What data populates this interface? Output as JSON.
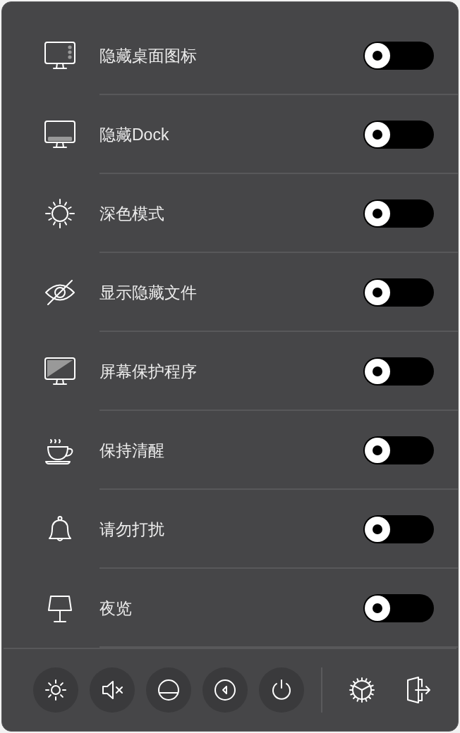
{
  "settings": [
    {
      "label": "隐藏桌面图标",
      "on": false
    },
    {
      "label": "隐藏Dock",
      "on": false
    },
    {
      "label": "深色模式",
      "on": false
    },
    {
      "label": "显示隐藏文件",
      "on": false
    },
    {
      "label": "屏幕保护程序",
      "on": false
    },
    {
      "label": "保持清醒",
      "on": false
    },
    {
      "label": "请勿打扰",
      "on": false
    },
    {
      "label": "夜览",
      "on": false
    }
  ]
}
